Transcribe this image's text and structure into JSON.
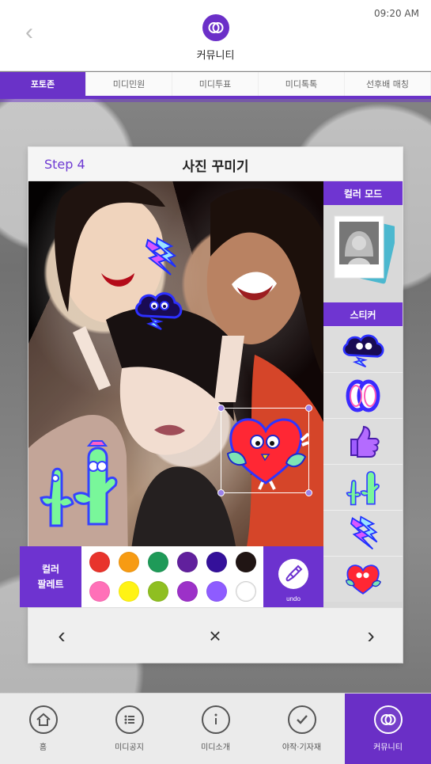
{
  "status": {
    "time": "09:20 AM"
  },
  "header": {
    "title": "커뮤니티",
    "back_icon": "chevron-left-icon",
    "community_icon": "community-rings-icon",
    "accent": "#6a32c8"
  },
  "tabs": [
    {
      "label": "포토존",
      "active": true
    },
    {
      "label": "미디민원",
      "active": false
    },
    {
      "label": "미디투표",
      "active": false
    },
    {
      "label": "미디톡톡",
      "active": false
    },
    {
      "label": "선후배 매칭",
      "active": false
    }
  ],
  "editor": {
    "step": "Step 4",
    "title": "사진 꾸미기",
    "color_mode": "컬러 모드",
    "sticker_title": "스티커",
    "palette_title": "컬러\n팔레트",
    "undo": "undo",
    "palette_colors": [
      "#e8342c",
      "#f79b13",
      "#1f9a58",
      "#61209d",
      "#34109a",
      "#201514",
      "#ff70b8",
      "#fff314",
      "#8fbf21",
      "#9c31c8",
      "#8e5cff",
      "#ffffff"
    ],
    "sticker_icons": [
      "storm-cloud-sticker",
      "rings-sticker",
      "thumbs-up-sticker",
      "cactus-sticker",
      "lightning-sticker",
      "heart-character-sticker"
    ]
  },
  "bottom_nav": [
    {
      "label": "홈",
      "icon": "home-icon",
      "active": false
    },
    {
      "label": "미디공지",
      "icon": "list-icon",
      "active": false
    },
    {
      "label": "미디소개",
      "icon": "info-icon",
      "active": false
    },
    {
      "label": "야작·기자재",
      "icon": "check-icon",
      "active": false
    },
    {
      "label": "커뮤니티",
      "icon": "community-rings-icon",
      "active": true
    }
  ]
}
